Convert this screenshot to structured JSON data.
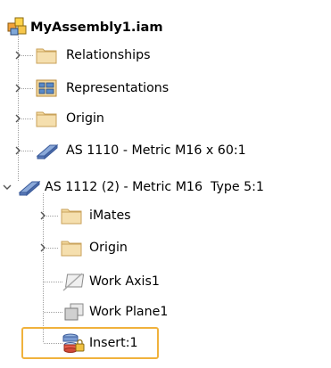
{
  "tree": {
    "root": {
      "label": "MyAssembly1.iam",
      "icon": "assembly-icon"
    },
    "items": [
      {
        "label": "Relationships",
        "icon": "folder-icon",
        "expander": "collapsed"
      },
      {
        "label": "Representations",
        "icon": "representations-icon",
        "expander": "collapsed"
      },
      {
        "label": "Origin",
        "icon": "folder-icon",
        "expander": "collapsed"
      },
      {
        "label": "AS 1110 - Metric M16 x 60:1",
        "icon": "part-bolt-icon",
        "expander": "collapsed"
      },
      {
        "label": "AS 1112 (2) - Metric M16  Type 5:1",
        "icon": "part-nut-icon",
        "expander": "expanded"
      },
      {
        "label": "iMates",
        "icon": "folder-icon",
        "expander": "collapsed"
      },
      {
        "label": "Origin",
        "icon": "folder-icon",
        "expander": "collapsed"
      },
      {
        "label": "Work Axis1",
        "icon": "work-axis-icon",
        "expander": "none"
      },
      {
        "label": "Work Plane1",
        "icon": "work-plane-icon",
        "expander": "none"
      },
      {
        "label": "Insert:1",
        "icon": "insert-constraint-icon",
        "expander": "none",
        "highlighted": true
      }
    ]
  },
  "colors": {
    "highlight_border": "#f0b23c",
    "folder_fill": "#f3d9a0",
    "folder_stroke": "#c9a25a",
    "tree_lines": "#a0a0a0"
  }
}
